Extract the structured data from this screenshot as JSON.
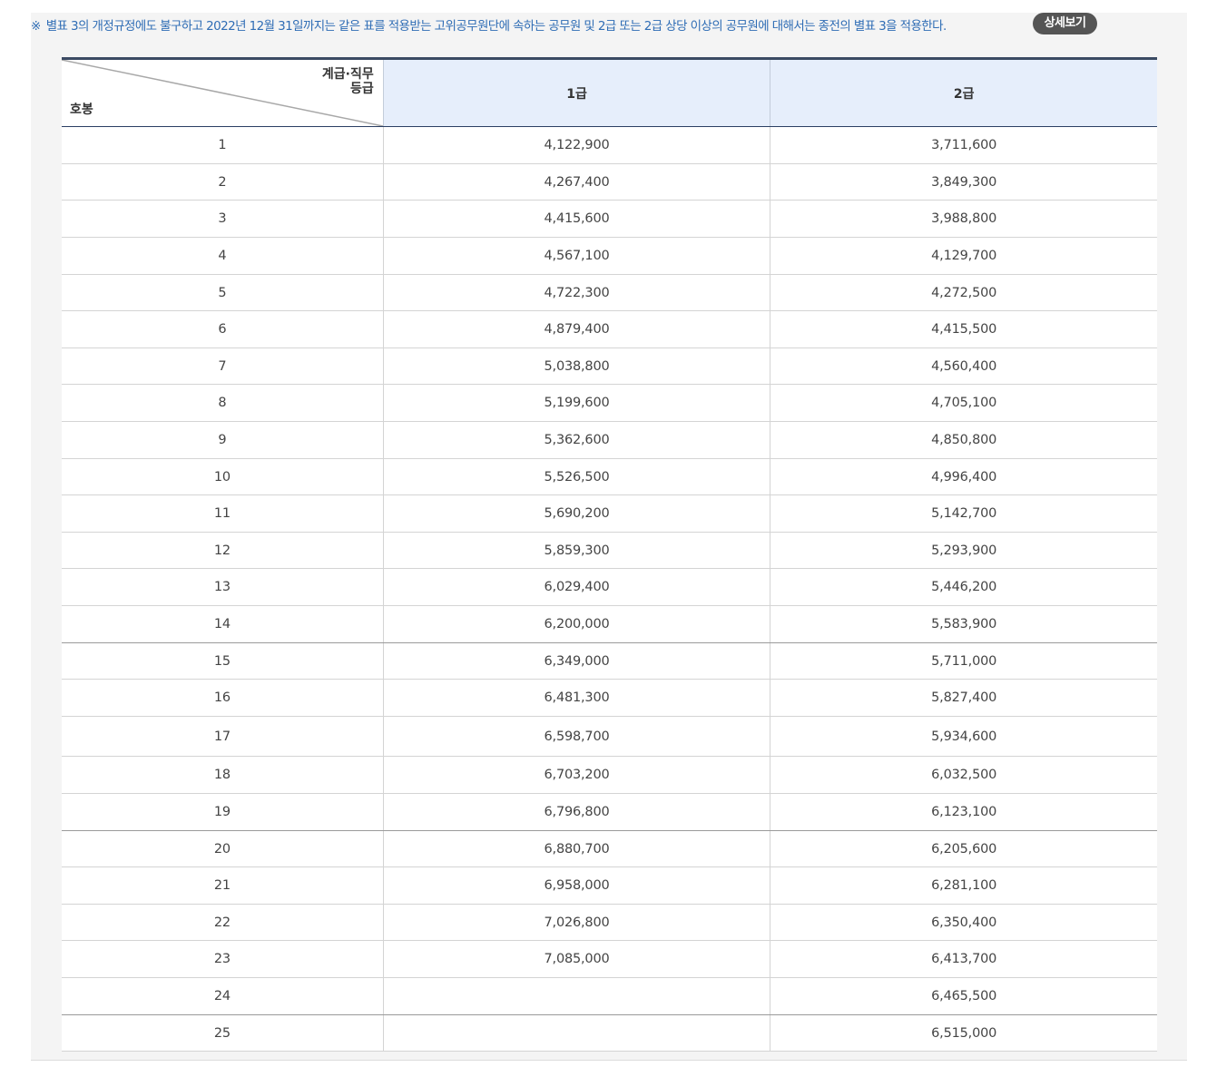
{
  "notice": {
    "mark": "※",
    "text": "별표 3의 개정규정에도 불구하고 2022년 12월 31일까지는 같은 표를 적용받는 고위공무원단에 속하는 공무원 및 2급 또는 2급 상당 이상의 공무원에 대해서는 종전의 별표 3을 적용한다.",
    "button_label": "상세보기"
  },
  "table": {
    "header": {
      "corner_top_line1": "계급·직무",
      "corner_top_line2": "등급",
      "corner_bottom": "호봉",
      "col1": "1급",
      "col2": "2급"
    },
    "rows": [
      {
        "step": "1",
        "g1": "4,122,900",
        "g2": "3,711,600"
      },
      {
        "step": "2",
        "g1": "4,267,400",
        "g2": "3,849,300"
      },
      {
        "step": "3",
        "g1": "4,415,600",
        "g2": "3,988,800"
      },
      {
        "step": "4",
        "g1": "4,567,100",
        "g2": "4,129,700"
      },
      {
        "step": "5",
        "g1": "4,722,300",
        "g2": "4,272,500"
      },
      {
        "step": "6",
        "g1": "4,879,400",
        "g2": "4,415,500"
      },
      {
        "step": "7",
        "g1": "5,038,800",
        "g2": "4,560,400"
      },
      {
        "step": "8",
        "g1": "5,199,600",
        "g2": "4,705,100"
      },
      {
        "step": "9",
        "g1": "5,362,600",
        "g2": "4,850,800"
      },
      {
        "step": "10",
        "g1": "5,526,500",
        "g2": "4,996,400"
      },
      {
        "step": "11",
        "g1": "5,690,200",
        "g2": "5,142,700"
      },
      {
        "step": "12",
        "g1": "5,859,300",
        "g2": "5,293,900"
      },
      {
        "step": "13",
        "g1": "6,029,400",
        "g2": "5,446,200"
      },
      {
        "step": "14",
        "g1": "6,200,000",
        "g2": "5,583,900"
      },
      {
        "step": "15",
        "g1": "6,349,000",
        "g2": "5,711,000"
      },
      {
        "step": "16",
        "g1": "6,481,300",
        "g2": "5,827,400"
      },
      {
        "step": "17",
        "g1": "6,598,700",
        "g2": "5,934,600"
      },
      {
        "step": "18",
        "g1": "6,703,200",
        "g2": "6,032,500"
      },
      {
        "step": "19",
        "g1": "6,796,800",
        "g2": "6,123,100"
      },
      {
        "step": "20",
        "g1": "6,880,700",
        "g2": "6,205,600"
      },
      {
        "step": "21",
        "g1": "6,958,000",
        "g2": "6,281,100"
      },
      {
        "step": "22",
        "g1": "7,026,800",
        "g2": "6,350,400"
      },
      {
        "step": "23",
        "g1": "7,085,000",
        "g2": "6,413,700"
      },
      {
        "step": "24",
        "g1": "",
        "g2": "6,465,500"
      },
      {
        "step": "25",
        "g1": "",
        "g2": "6,515,000"
      }
    ]
  }
}
